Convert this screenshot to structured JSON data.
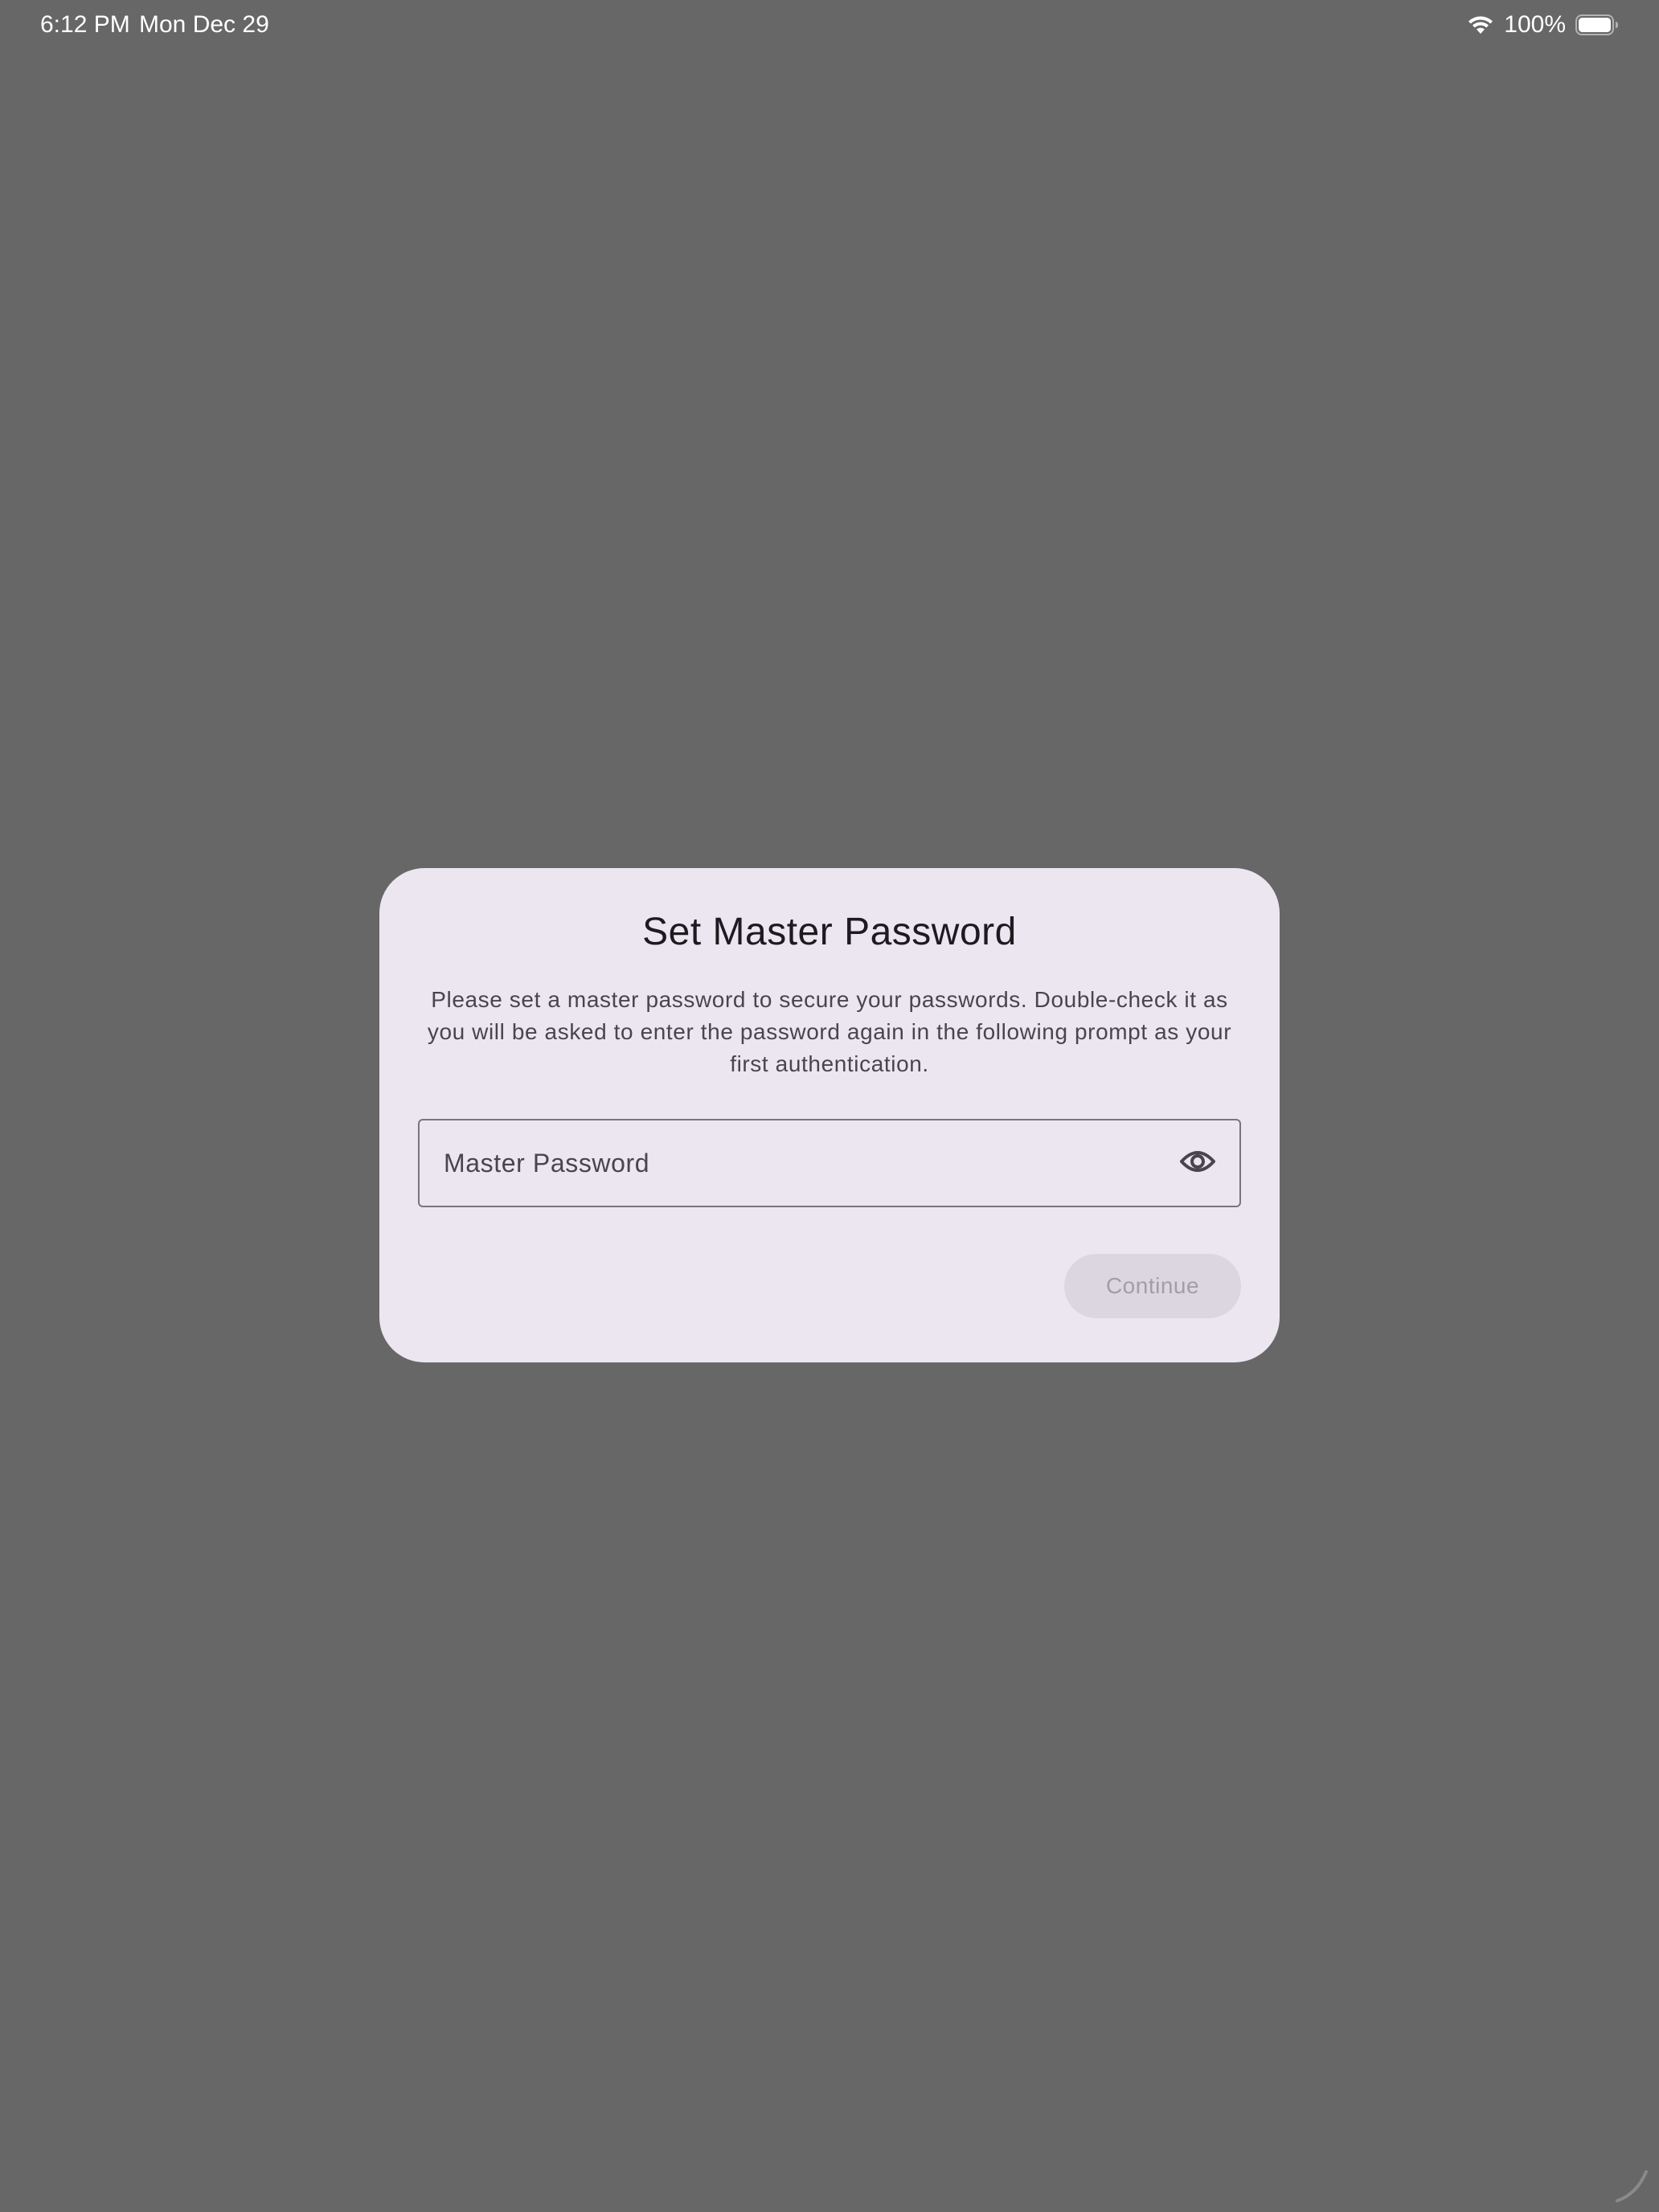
{
  "status_bar": {
    "time": "6:12 PM",
    "date": "Mon Dec 29",
    "battery_percent": "100%",
    "icons": [
      "wifi-icon",
      "battery-icon"
    ]
  },
  "dialog": {
    "title": "Set Master Password",
    "message": "Please set a master password to secure your passwords. Double-check it as you will be asked to enter the password again in the following prompt as your first authentication.",
    "password_field": {
      "placeholder": "Master Password",
      "value": "",
      "toggle_icon": "eye-icon"
    },
    "continue_label": "Continue",
    "continue_enabled": false
  },
  "colors": {
    "background": "#676767",
    "dialog_surface": "#ece6f0",
    "title_text": "#1d1b20",
    "body_text": "#49454f",
    "outline": "#79747e",
    "disabled_button_bg": "#dcd6e0",
    "disabled_button_text": "#a29da6"
  }
}
